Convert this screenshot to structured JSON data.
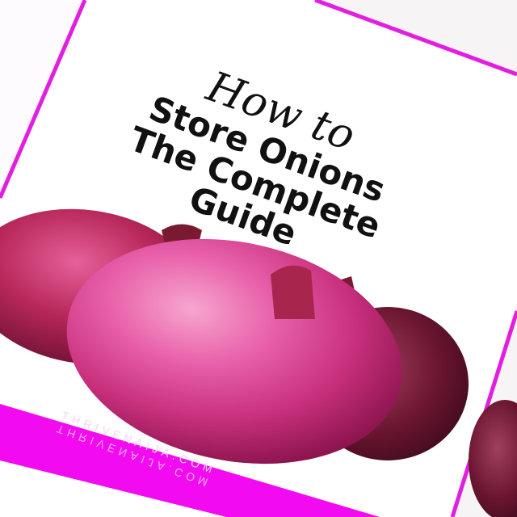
{
  "title": {
    "script_line": "How to",
    "line1": "Store Onions",
    "line2": "The Complete",
    "line3": "Guide"
  },
  "footer": {
    "website": "THRIVENAIJA.COM"
  },
  "colors": {
    "accent": "#e21ee0",
    "band": "#f20af0"
  }
}
